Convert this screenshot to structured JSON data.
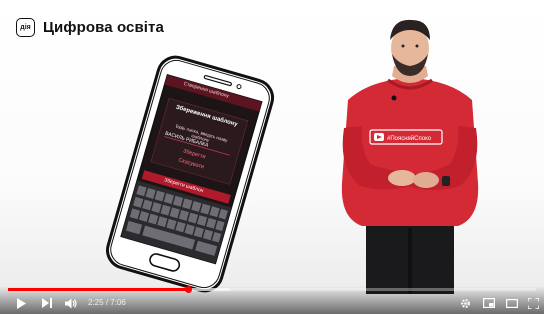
{
  "header": {
    "logo_text": "дія",
    "title": "Цифрова освіта"
  },
  "phone_screen": {
    "top_bar": "Створення шаблону",
    "dialog_title": "Збереження шаблону",
    "dialog_text": "Будь ласка, введіть назву шаблону",
    "field_value": "ВАСИЛЬ РИБАЛКА",
    "save_label": "Зберегти",
    "cancel_label": "Скасувати",
    "bottom_button": "Зберегти шаблон"
  },
  "presenter": {
    "shirt_text": "#ПоясняйСпоко"
  },
  "player": {
    "time_current": "2:25",
    "time_separator": "/",
    "time_total": "7:06",
    "progress_fraction": 0.34,
    "buffer_fraction": 0.42,
    "accent_color": "#ff0000",
    "icons": [
      "play-icon",
      "next-icon",
      "volume-icon",
      "settings-icon",
      "miniplayer-icon",
      "theater-icon",
      "fullscreen-icon"
    ]
  }
}
